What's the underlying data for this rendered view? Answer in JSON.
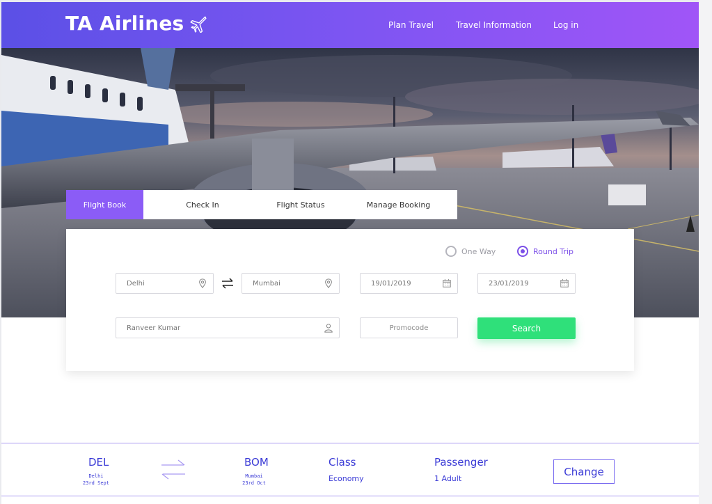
{
  "header": {
    "brand": "TA Airlines",
    "nav": [
      "Plan Travel",
      "Travel Information",
      "Log in"
    ],
    "colors": {
      "gradient_start": "#5b50e6",
      "gradient_end": "#a055f7"
    }
  },
  "tabs": [
    {
      "label": "Flight Book",
      "active": true
    },
    {
      "label": "Check In",
      "active": false
    },
    {
      "label": "Flight Status",
      "active": false
    },
    {
      "label": "Manage Booking",
      "active": false
    }
  ],
  "booking": {
    "trip_type": {
      "one_way": "One Way",
      "round_trip": "Round Trip",
      "selected": "Round Trip"
    },
    "from": "Delhi",
    "to": "Mumbai",
    "depart_date": "19/01/2019",
    "return_date": "23/01/2019",
    "passenger_name": "Ranveer Kumar",
    "promocode_placeholder": "Promocode",
    "search_label": "Search",
    "icons": [
      "location-pin-icon",
      "swap-arrows-icon",
      "calendar-icon",
      "user-icon"
    ]
  },
  "summary": {
    "origin": {
      "code": "DEL",
      "city": "Delhi",
      "date": "23rd Sept"
    },
    "destination": {
      "code": "BOM",
      "city": "Mumbai",
      "date": "23rd Oct"
    },
    "class_label": "Class",
    "class_value": "Economy",
    "passenger_label": "Passenger",
    "passenger_value": "1 Adult",
    "change_label": "Change"
  },
  "colors": {
    "accent": "#8b5cf6",
    "search": "#2fe07a",
    "summary_text": "#3b3bd6"
  }
}
